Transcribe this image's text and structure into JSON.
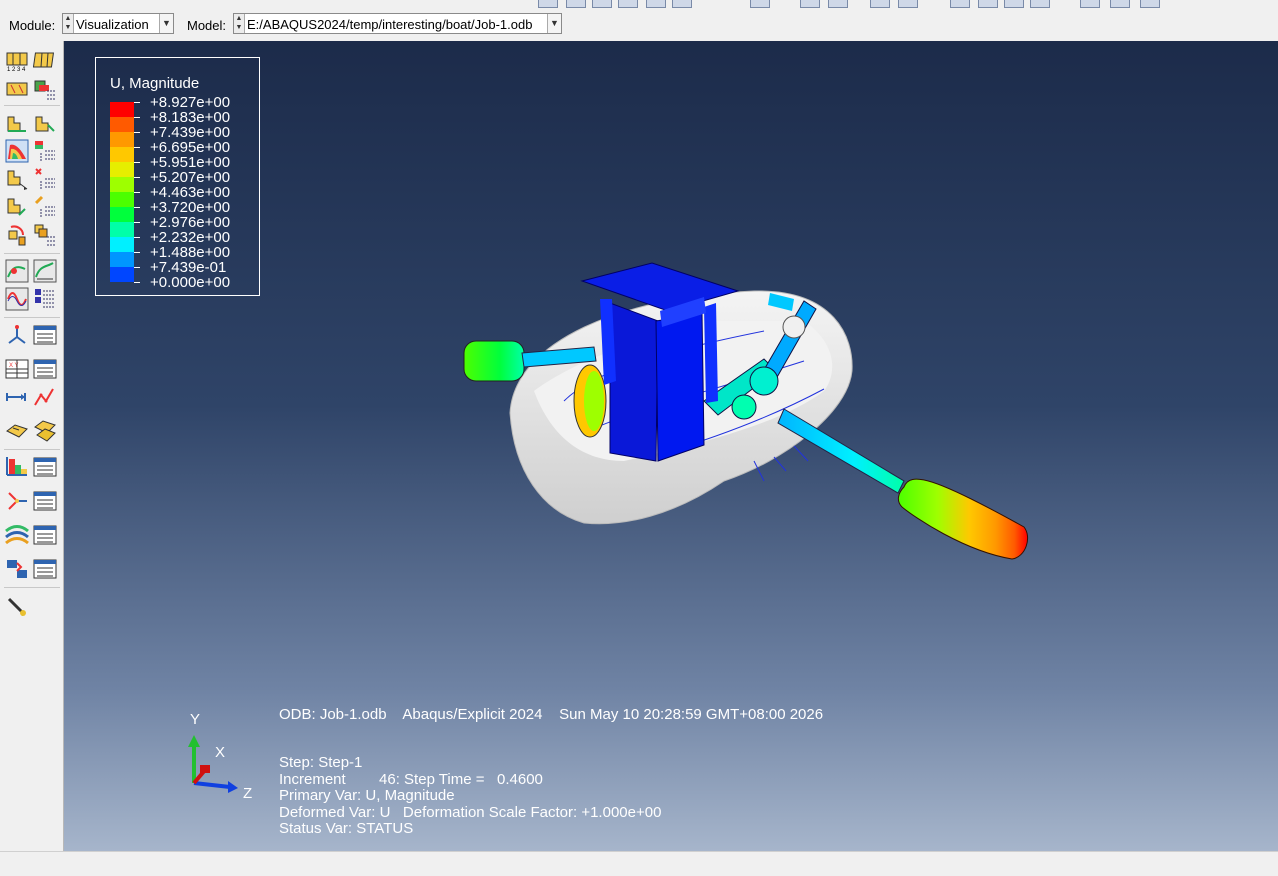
{
  "context_bar": {
    "module_label": "Module:",
    "module_value": "Visualization",
    "model_label": "Model:",
    "model_value": "E:/ABAQUS2024/temp/interesting/boat/Job-1.odb"
  },
  "legend": {
    "title": "U, Magnitude",
    "entries": [
      {
        "label": "+8.927e+00",
        "color": "#ff0000"
      },
      {
        "label": "+8.183e+00",
        "color": "#ff5a00"
      },
      {
        "label": "+7.439e+00",
        "color": "#ff9900"
      },
      {
        "label": "+6.695e+00",
        "color": "#ffc800"
      },
      {
        "label": "+5.951e+00",
        "color": "#e6ee00"
      },
      {
        "label": "+5.207e+00",
        "color": "#9eff00"
      },
      {
        "label": "+4.463e+00",
        "color": "#4cff00"
      },
      {
        "label": "+3.720e+00",
        "color": "#00ff3c"
      },
      {
        "label": "+2.976e+00",
        "color": "#00ffa8"
      },
      {
        "label": "+2.232e+00",
        "color": "#00f0ff"
      },
      {
        "label": "+1.488e+00",
        "color": "#0096ff"
      },
      {
        "label": "+7.439e-01",
        "color": "#0046ff"
      },
      {
        "label": "+0.000e+00",
        "color": "#0000ff"
      }
    ]
  },
  "triad": {
    "y": "Y",
    "x": "X",
    "z": "Z"
  },
  "info_block": {
    "line1": "ODB: Job-1.odb    Abaqus/Explicit 2024    Sun May 10 20:28:59 GMT+08:00 2026",
    "line2": "Step: Step-1",
    "line3": "Increment        46: Step Time =   0.4600",
    "line4": "Primary Var: U, Magnitude",
    "line5": "Deformed Var: U   Deformation Scale Factor: +1.000e+00",
    "line6": "Status Var: STATUS"
  },
  "colors": {
    "viewport_top": "#1c2b4a",
    "viewport_bottom": "#a6b5cb",
    "hull": "#e6e6e6",
    "frame": "#0a1ee6"
  }
}
